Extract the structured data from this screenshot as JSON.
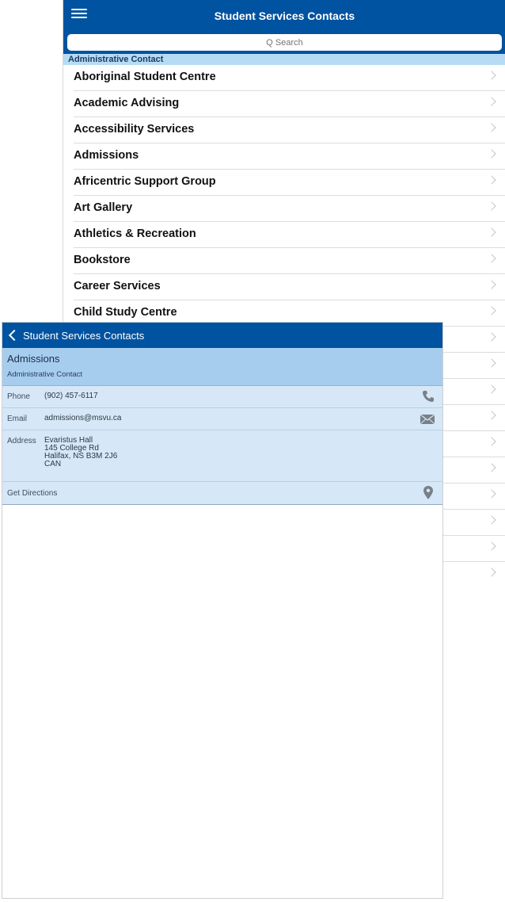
{
  "list_screen": {
    "title": "Student Services Contacts",
    "search_placeholder": "Q Search",
    "section_header": "Administrative Contact",
    "items": [
      "Aboriginal Student Centre",
      "Academic Advising",
      "Accessibility Services",
      "Admissions",
      "Africentric Support Group",
      "Art Gallery",
      "Athletics & Recreation",
      "Bookstore",
      "Career Services",
      "Child Study Centre",
      "",
      "",
      "",
      "",
      "",
      "",
      "",
      "",
      "",
      ""
    ]
  },
  "detail": {
    "back_label": "Student Services Contacts",
    "name": "Admissions",
    "subtitle": "Administrative Contact",
    "phone_label": "Phone",
    "phone_value": "(902) 457-6117",
    "email_label": "Email",
    "email_value": "admissions@msvu.ca",
    "address_label": "Address",
    "address_lines": [
      "Evaristus Hall",
      "145 College Rd",
      "Halifax, NS  B3M 2J6",
      "CAN"
    ],
    "directions_label": "Get Directions"
  },
  "colors": {
    "nav_blue": "#0053a0",
    "header_light_blue": "#a6cdee",
    "section_blue": "#b6dbf4",
    "row_blue": "#d6e8f7",
    "icon_gray": "#7a8088"
  },
  "icons": [
    "menu-icon",
    "search-icon",
    "chevron-right-icon",
    "back-chevron-icon",
    "phone-icon",
    "mail-icon",
    "map-pin-icon"
  ]
}
